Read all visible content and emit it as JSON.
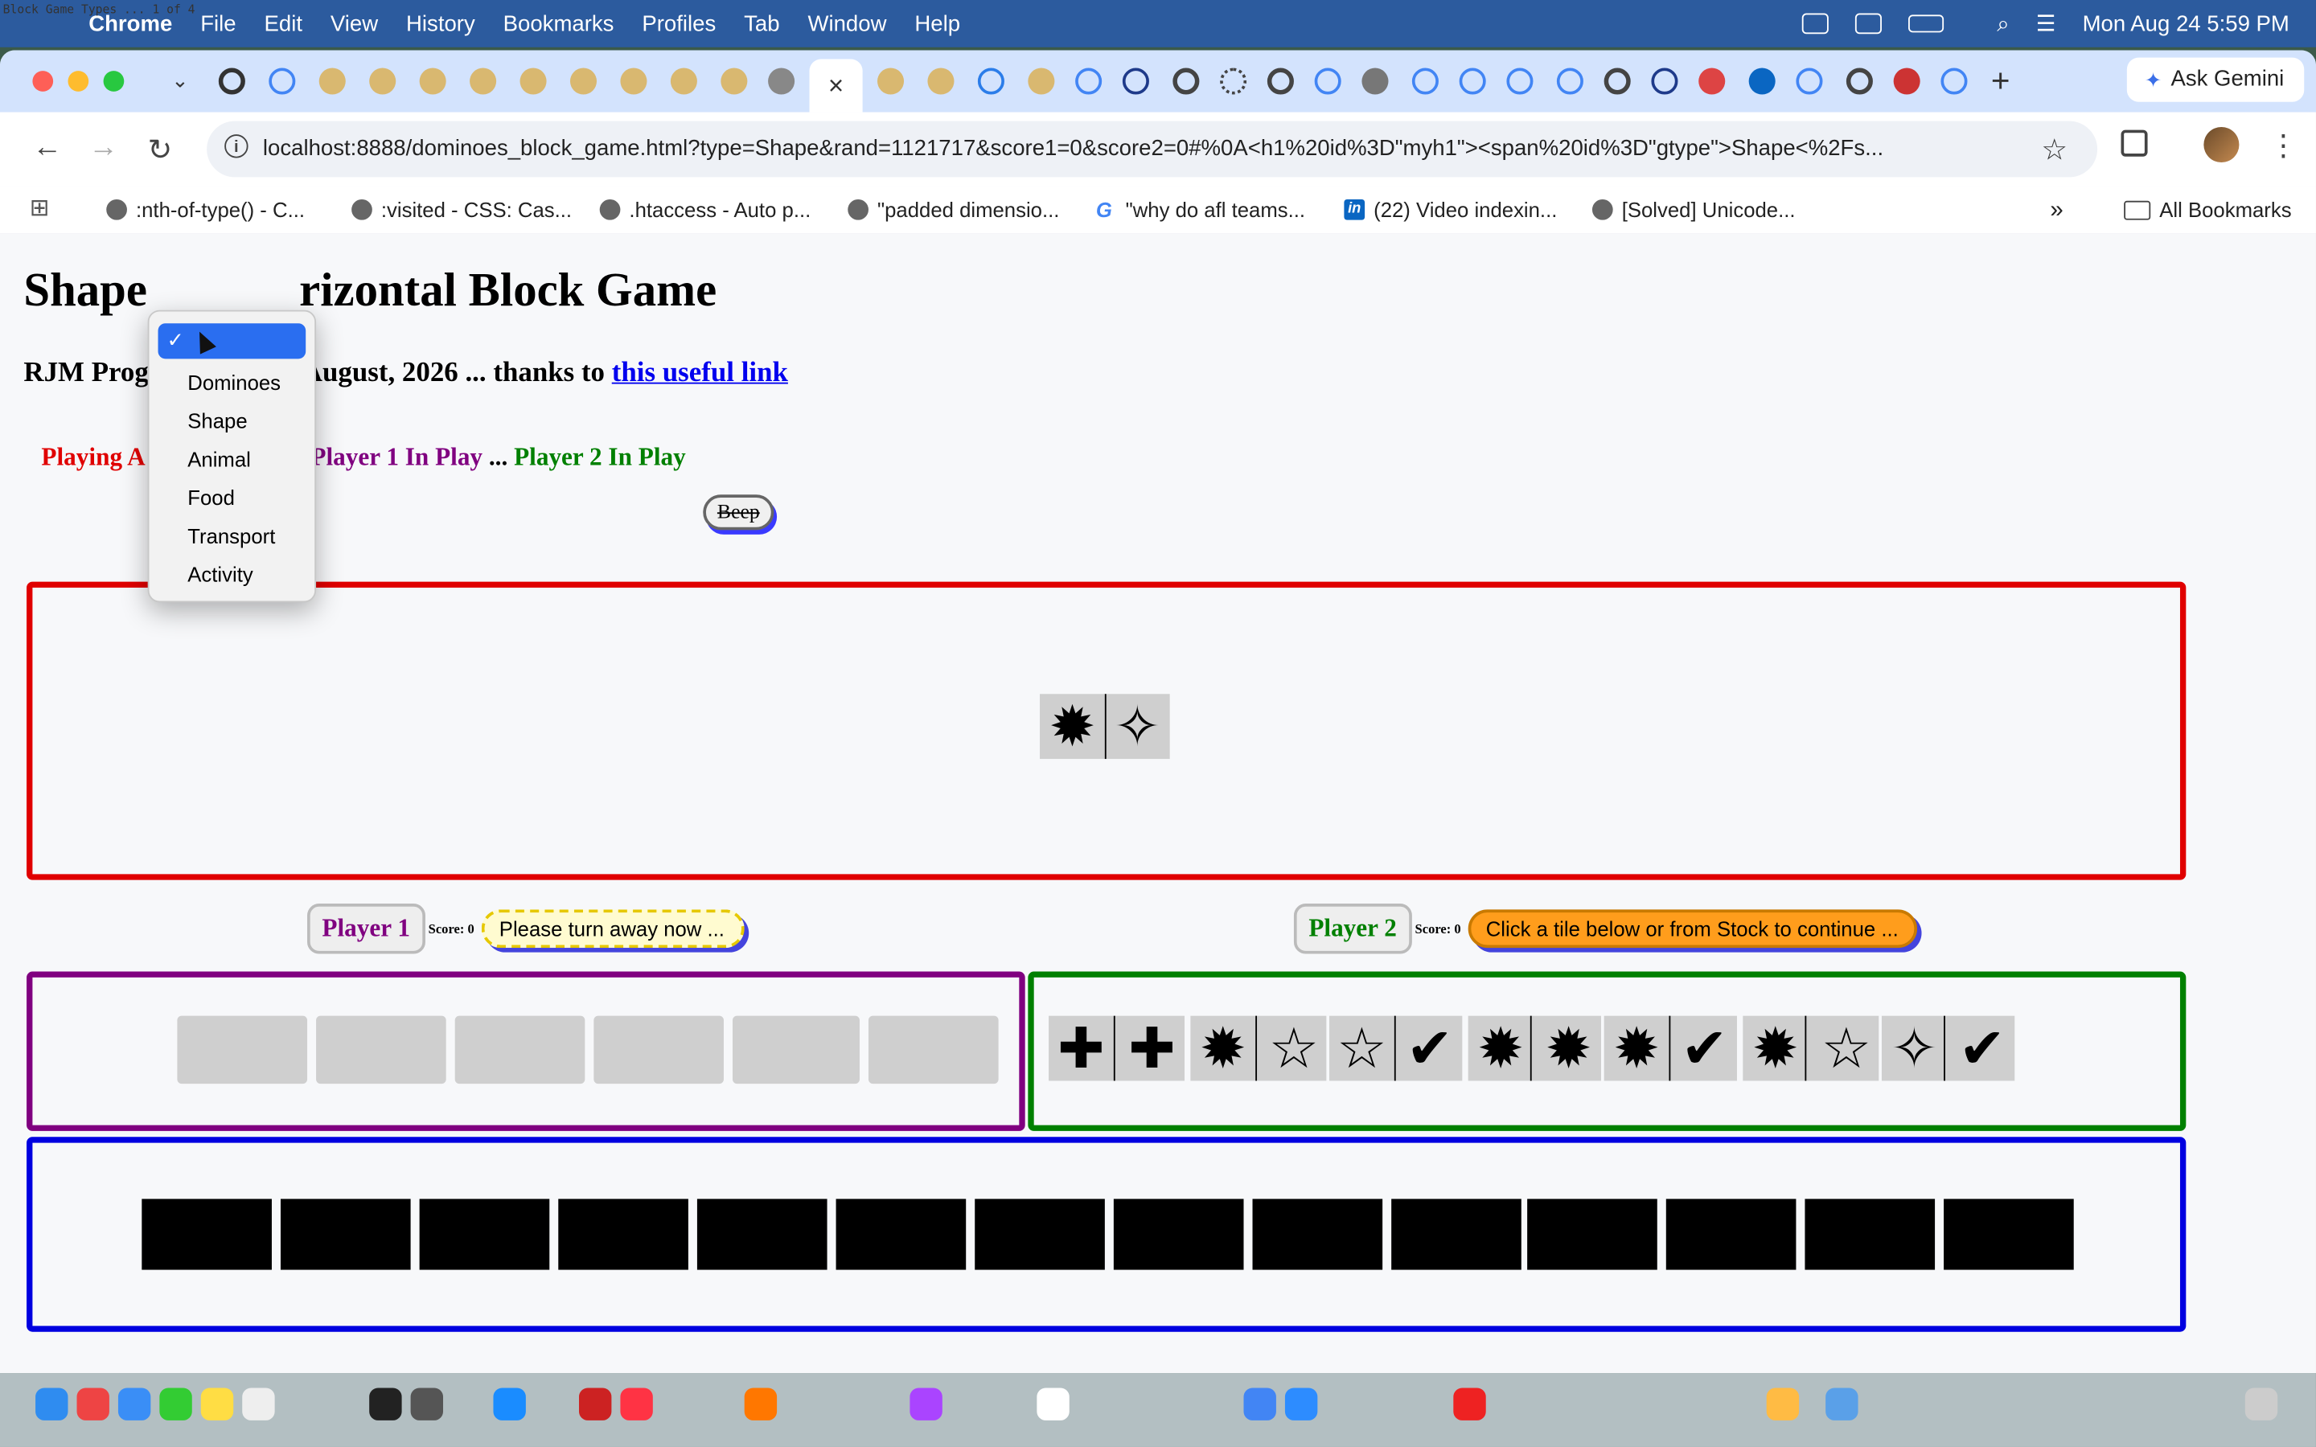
{
  "menubar": {
    "app": "Chrome",
    "items": [
      "File",
      "Edit",
      "View",
      "History",
      "Bookmarks",
      "Profiles",
      "Tab",
      "Window",
      "Help"
    ],
    "datetime": "Mon Aug 24  5:59 PM"
  },
  "corner_title": "Block Game Types ... 1 of 4",
  "tabs": {
    "ask_gemini": "Ask Gemini",
    "active_close": "×"
  },
  "toolbar": {
    "url": "localhost:8888/dominoes_block_game.html?type=Shape&rand=1121717&score1=0&score2=0#%0A<h1%20id%3D\"myh1\"><span%20id%3D\"gtype\">Shape<%2Fs..."
  },
  "bookmarks": [
    ":nth-of-type() - C...",
    ":visited - CSS: Cas...",
    ".htaccess - Auto p...",
    "\"padded dimensio...",
    "\"why do afl teams...",
    "(22) Video indexin...",
    "[Solved] Unicode..."
  ],
  "all_bookmarks": "All Bookmarks",
  "page": {
    "title_left": "Shape",
    "title_right": "rizontal Block Game",
    "byline_left": "RJM Prog",
    "byline_mid": "August, 2026 ... thanks to ",
    "byline_link": "this useful link",
    "status_playing": "Playing A",
    "status_p1": "Player 1 In Play",
    "status_sep": " ... ",
    "status_p2": "Player 2 In Play",
    "beep": "Beep"
  },
  "dropdown": {
    "selected": "",
    "options": [
      "Dominoes",
      "Shape",
      "Animal",
      "Food",
      "Transport",
      "Activity"
    ]
  },
  "table_tile": [
    "✹",
    "✧"
  ],
  "player1": {
    "label": "Player 1",
    "score": "Score: 0",
    "message": "Please turn away now ..."
  },
  "player2": {
    "label": "Player 2",
    "score": "Score: 0",
    "message": "Click a tile below or from Stock to continue ...",
    "tiles": [
      [
        "✚",
        "✚"
      ],
      [
        "✹",
        "☆"
      ],
      [
        "☆",
        "✔"
      ],
      [
        "✹",
        "✹"
      ],
      [
        "✹",
        "✔"
      ],
      [
        "✹",
        "☆"
      ],
      [
        "✧",
        "✔"
      ]
    ]
  },
  "colors": {
    "table_border": "#e00000",
    "player1_border": "#800080",
    "player2_border": "#008000",
    "stock_border": "#0000e0",
    "menubar": "#2c5b9e"
  }
}
